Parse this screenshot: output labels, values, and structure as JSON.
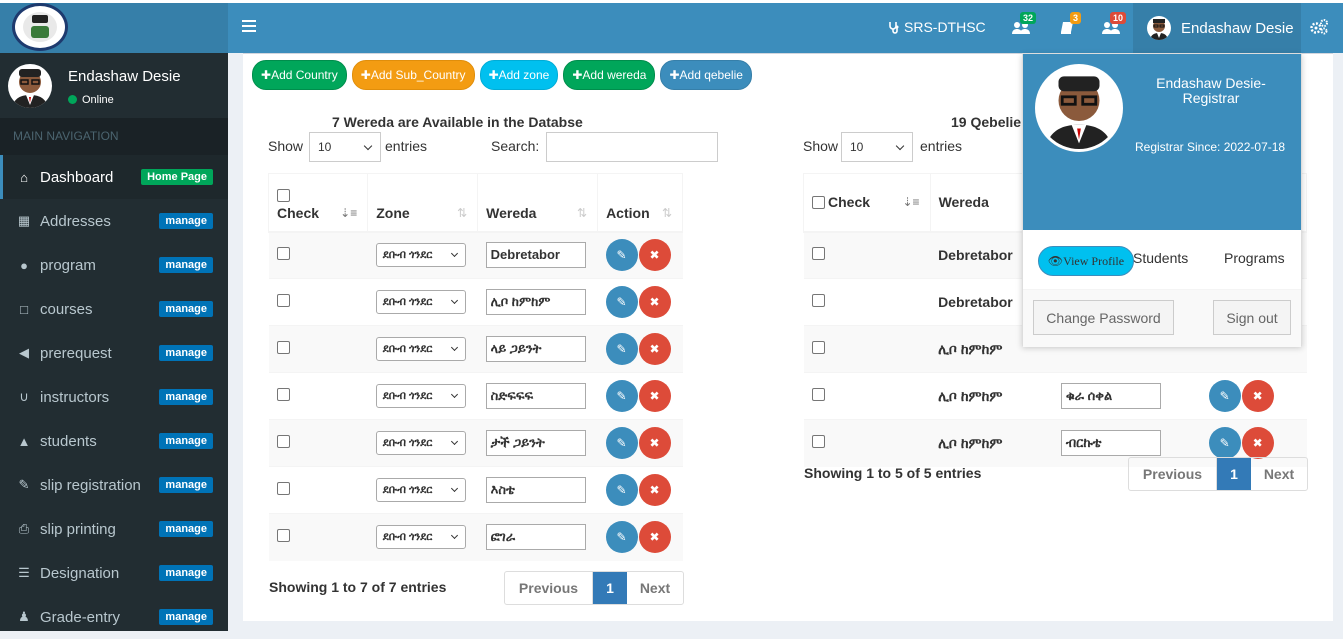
{
  "app": {
    "brand": "SRS-DTHSC"
  },
  "navbar": {
    "notifications": [
      {
        "icon": "users-icon",
        "count": "32",
        "color": "#00a65a"
      },
      {
        "icon": "book-icon",
        "count": "3",
        "color": "#f39c12"
      },
      {
        "icon": "user-group-icon",
        "count": "10",
        "color": "#dd4b39"
      }
    ],
    "user_name": "Endashaw Desie"
  },
  "sidebar": {
    "user_name": "Endashaw Desie",
    "status": "Online",
    "header": "MAIN NAVIGATION",
    "items": [
      {
        "label": "Dashboard",
        "tag": "Home Page",
        "icon": "home-icon"
      },
      {
        "label": "Addresses",
        "tag": "manage",
        "icon": "building-icon"
      },
      {
        "label": "program",
        "tag": "manage",
        "icon": "tint-icon"
      },
      {
        "label": "courses",
        "tag": "manage",
        "icon": "folder-icon"
      },
      {
        "label": "prerequest",
        "tag": "manage",
        "icon": "backward-icon"
      },
      {
        "label": "instructors",
        "tag": "manage",
        "icon": "stethoscope-icon"
      },
      {
        "label": "students",
        "tag": "manage",
        "icon": "graduation-cap-icon"
      },
      {
        "label": "slip registration",
        "tag": "manage",
        "icon": "edit-icon"
      },
      {
        "label": "slip printing",
        "tag": "manage",
        "icon": "print-icon"
      },
      {
        "label": "Designation",
        "tag": "manage",
        "icon": "list-icon"
      },
      {
        "label": "Grade-entry",
        "tag": "manage",
        "icon": "users-icon"
      }
    ]
  },
  "add_buttons": [
    {
      "label": "Add Country",
      "color": "#00a65a"
    },
    {
      "label": "Add Sub_Country",
      "color": "#f39c12"
    },
    {
      "label": "Add zone",
      "color": "#00c0ef"
    },
    {
      "label": "Add wereda",
      "color": "#00a65a"
    },
    {
      "label": "Add qebelie",
      "color": "#3c8dbc"
    }
  ],
  "wereda_table": {
    "title": "7 Wereda are Available in the Databse",
    "show_label": "Show",
    "entries_value": "10",
    "entries_label": "entries",
    "search_label": "Search:",
    "columns": [
      "Check",
      "Zone",
      "Wereda",
      "Action"
    ],
    "rows": [
      {
        "zone": "ደቡብ ጎንደር",
        "wereda": "Debretabor"
      },
      {
        "zone": "ደቡብ ጎንደር",
        "wereda": "ሊቦ ከምከም"
      },
      {
        "zone": "ደቡብ ጎንደር",
        "wereda": "ላይ ጋይንት"
      },
      {
        "zone": "ደቡብ ጎንደር",
        "wereda": "ስድፍፍፍ"
      },
      {
        "zone": "ደቡብ ጎንደር",
        "wereda": "ታች ጋይንት"
      },
      {
        "zone": "ደቡብ ጎንደር",
        "wereda": "እስቴ"
      },
      {
        "zone": "ደቡብ ጎንደር",
        "wereda": "ፎገራ"
      }
    ],
    "showing": "Showing 1 to 7 of 7 entries",
    "prev": "Previous",
    "page": "1",
    "next": "Next"
  },
  "qebelie_table": {
    "title": "19 Qebelie",
    "show_label": "Show",
    "entries_value": "10",
    "entries_label": "entries",
    "columns": [
      "Check",
      "Wereda"
    ],
    "rows": [
      {
        "wereda": "Debretabor",
        "qebelie": ""
      },
      {
        "wereda": "Debretabor",
        "qebelie": ""
      },
      {
        "wereda": "ሊቦ ከምከም",
        "qebelie": ""
      },
      {
        "wereda": "ሊቦ ከምከም",
        "qebelie": "ቁራ ሰቀል"
      },
      {
        "wereda": "ሊቦ ከምከም",
        "qebelie": "ብርኩቴ"
      }
    ],
    "showing": "Showing 1 to 5 of 5 entries",
    "prev": "Previous",
    "page": "1",
    "next": "Next"
  },
  "user_dropdown": {
    "name": "Endashaw Desie- Registrar",
    "since": "Registrar Since: 2022-07-18",
    "view_profile": "View Profile",
    "students": "Students",
    "programs": "Programs",
    "change_password": "Change Password",
    "sign_out": "Sign out"
  }
}
